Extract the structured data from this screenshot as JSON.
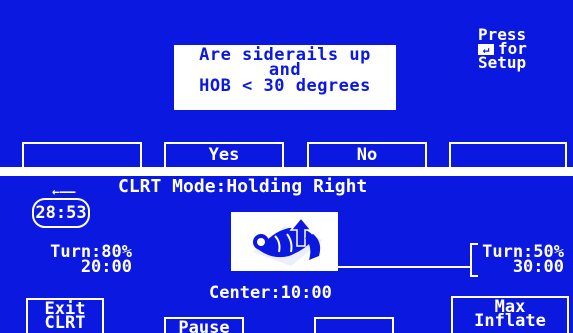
{
  "prompt_screen": {
    "question_lines": [
      "Are siderails up",
      "and",
      "HOB < 30 degrees"
    ],
    "press_hint": {
      "line1": "Press",
      "enter_glyph": "↵",
      "line2": "for",
      "line3": "Setup"
    },
    "softkeys": [
      "",
      "Yes",
      "No",
      ""
    ]
  },
  "clrt_screen": {
    "timer": "28:53",
    "mode_title": "CLRT Mode:Holding Right",
    "turn_left": {
      "percent": "Turn:80%",
      "time": "20:00"
    },
    "turn_right": {
      "percent": "Turn:50%",
      "time": "30:00"
    },
    "center": "Center:10:00",
    "softkeys": [
      {
        "line1": "Exit",
        "line2": "CLRT"
      },
      {
        "line1": "Pause",
        "line2": ""
      },
      {
        "line1": "",
        "line2": ""
      },
      {
        "line1": "Max",
        "line2": "Inflate"
      }
    ]
  },
  "colors": {
    "screen_bg": "#0a18e0",
    "text": "#ffffff",
    "separator": "#ffffff"
  },
  "icons": [
    "enter-key-icon",
    "rotation-arrow-icon",
    "patient-turn-icon"
  ]
}
